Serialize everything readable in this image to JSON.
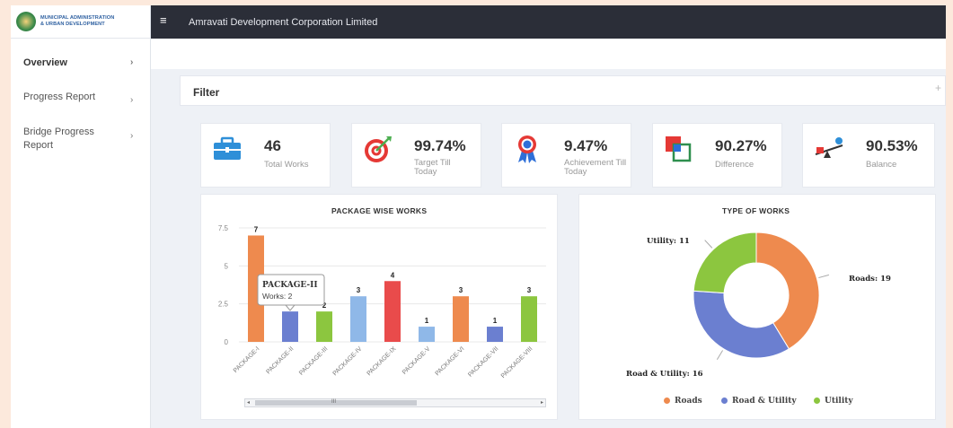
{
  "header": {
    "logo_line1": "MUNICIPAL ADMINISTRATION",
    "logo_line2": "& URBAN DEVELOPMENT",
    "title": "Amravati Development Corporation Limited",
    "menu_icon": "hamburger-icon"
  },
  "sidebar": {
    "items": [
      {
        "label": "Overview",
        "active": true
      },
      {
        "label": "Progress Report",
        "active": false
      },
      {
        "label": "Bridge Progress Report",
        "active": false
      }
    ]
  },
  "filter": {
    "title": "Filter",
    "expand": "+"
  },
  "cards": [
    {
      "value": "46",
      "label": "Total Works",
      "icon": "briefcase-icon"
    },
    {
      "value": "99.74%",
      "label": "Target Till Today",
      "icon": "target-icon"
    },
    {
      "value": "9.47%",
      "label": "Achievement Till Today",
      "icon": "award-ribbon-icon"
    },
    {
      "value": "90.27%",
      "label": "Difference",
      "icon": "difference-icon"
    },
    {
      "value": "90.53%",
      "label": "Balance",
      "icon": "seesaw-icon"
    }
  ],
  "colors": {
    "orange": "#ee8a4e",
    "blue": "#6b7fd0",
    "lightblue": "#8fb8e8",
    "green": "#8cc63f",
    "red": "#e94b4b",
    "dark": "#2b2e38"
  },
  "chart_data": [
    {
      "type": "bar",
      "title": "PACKAGE WISE WORKS",
      "categories": [
        "PACKAGE-I",
        "PACKAGE-II",
        "PACKAGE-III",
        "PACKAGE-IV",
        "PACKAGE-IX",
        "PACKAGE-V",
        "PACKAGE-VI",
        "PACKAGE-VII",
        "PACKAGE-VIII"
      ],
      "values": [
        7,
        2,
        2,
        3,
        4,
        1,
        3,
        1,
        3
      ],
      "bar_colors": [
        "#ee8a4e",
        "#6b7fd0",
        "#8cc63f",
        "#8fb8e8",
        "#e94b4b",
        "#8fb8e8",
        "#ee8a4e",
        "#6b7fd0",
        "#8cc63f"
      ],
      "yticks": [
        "0",
        "2.5",
        "5",
        "7.5"
      ],
      "ylim": [
        0,
        7.5
      ],
      "tooltip": {
        "title": "PACKAGE-II",
        "text": "Works: 2"
      },
      "scroll_label": "III"
    },
    {
      "type": "pie",
      "title": "TYPE OF WORKS",
      "labels": [
        "Roads",
        "Road & Utility",
        "Utility"
      ],
      "values": [
        19,
        16,
        11
      ],
      "slice_labels": [
        "Roads: 19",
        "Road & Utility: 16",
        "Utility: 11"
      ],
      "colors": [
        "#ee8a4e",
        "#6b7fd0",
        "#8cc63f"
      ],
      "legend_position": "bottom"
    }
  ]
}
